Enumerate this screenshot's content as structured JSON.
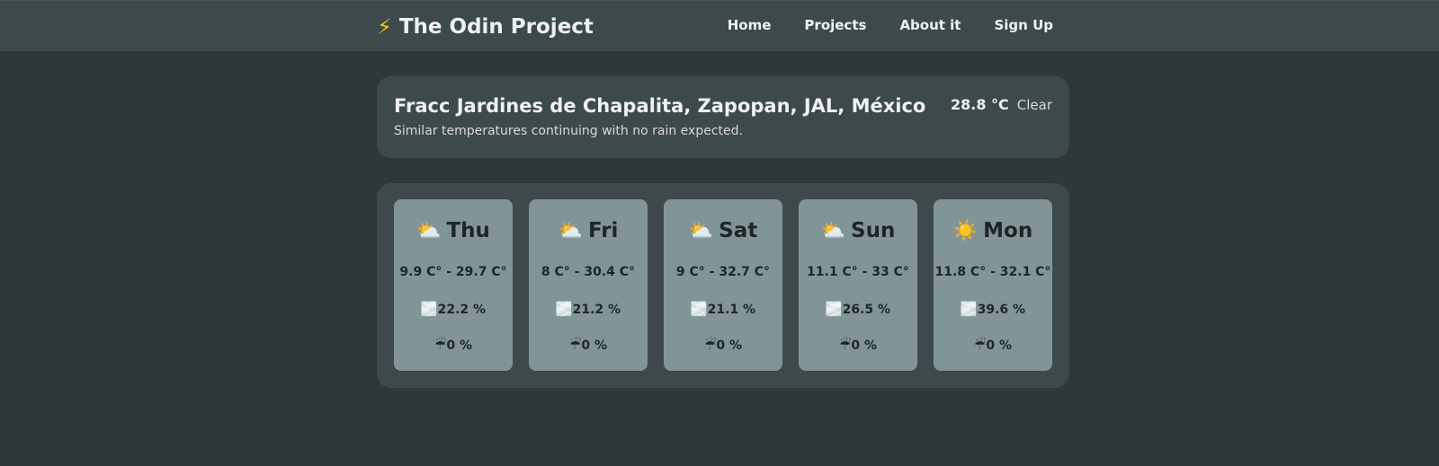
{
  "nav": {
    "brand_icon": "⚡",
    "brand": "The Odin Project",
    "links": [
      "Home",
      "Projects",
      "About it",
      "Sign Up"
    ]
  },
  "current": {
    "location": "Fracc Jardines de Chapalita, Zapopan, JAL, México",
    "summary": "Similar temperatures continuing with no rain expected.",
    "temperature": "28.8 °C",
    "condition": "Clear"
  },
  "forecast": [
    {
      "icon": "⛅",
      "day": "Thu",
      "range": "9.9 C° - 29.7 C°",
      "cloud_icon": "🌫️",
      "cloud": "22.2 %",
      "rain_icon": "☔",
      "rain": "0 %"
    },
    {
      "icon": "⛅",
      "day": "Fri",
      "range": "8 C° - 30.4 C°",
      "cloud_icon": "🌫️",
      "cloud": "21.2 %",
      "rain_icon": "☔",
      "rain": "0 %"
    },
    {
      "icon": "⛅",
      "day": "Sat",
      "range": "9 C° - 32.7 C°",
      "cloud_icon": "🌫️",
      "cloud": "21.1 %",
      "rain_icon": "☔",
      "rain": "0 %"
    },
    {
      "icon": "⛅",
      "day": "Sun",
      "range": "11.1 C° - 33 C°",
      "cloud_icon": "🌫️",
      "cloud": "26.5 %",
      "rain_icon": "☔",
      "rain": "0 %"
    },
    {
      "icon": "☀️",
      "day": "Mon",
      "range": "11.8 C° - 32.1 C°",
      "cloud_icon": "🌫️",
      "cloud": "39.6 %",
      "rain_icon": "☔",
      "rain": "0 %"
    }
  ],
  "colors": {
    "background": "#2e3739",
    "panel": "#3d4a4c",
    "card": "#819599",
    "brand_bolt": "#f5c400"
  }
}
